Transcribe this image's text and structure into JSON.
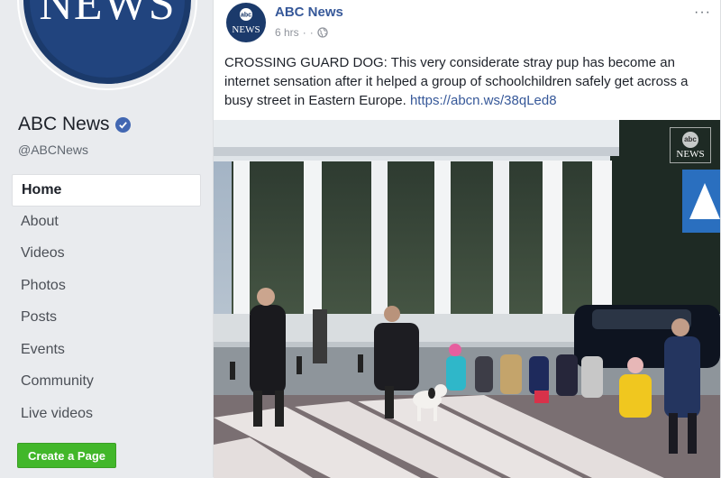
{
  "page": {
    "logo_text": "NEWS",
    "name": "ABC News",
    "handle": "@ABCNews",
    "nav_items": [
      "Home",
      "About",
      "Videos",
      "Photos",
      "Posts",
      "Events",
      "Community",
      "Live videos"
    ],
    "active_item": "Home",
    "create_button": "Create a Page"
  },
  "post": {
    "avatar_abc": "abc",
    "avatar_news": "NEWS",
    "author": "ABC News",
    "time": "6 hrs",
    "separator": "·",
    "more_icon": "···",
    "text": "CROSSING GUARD DOG: This very considerate stray pup has become an internet sensation after it helped a group of schoolchildren safely get across a busy street in Eastern Europe. ",
    "link": "https://abcn.ws/38qLed8",
    "watermark_abc": "abc",
    "watermark_news": "NEWS"
  },
  "colors": {
    "brand_blue": "#365899",
    "verified_blue": "#4267b2",
    "create_green": "#42b72a",
    "background": "#e9ebee"
  }
}
